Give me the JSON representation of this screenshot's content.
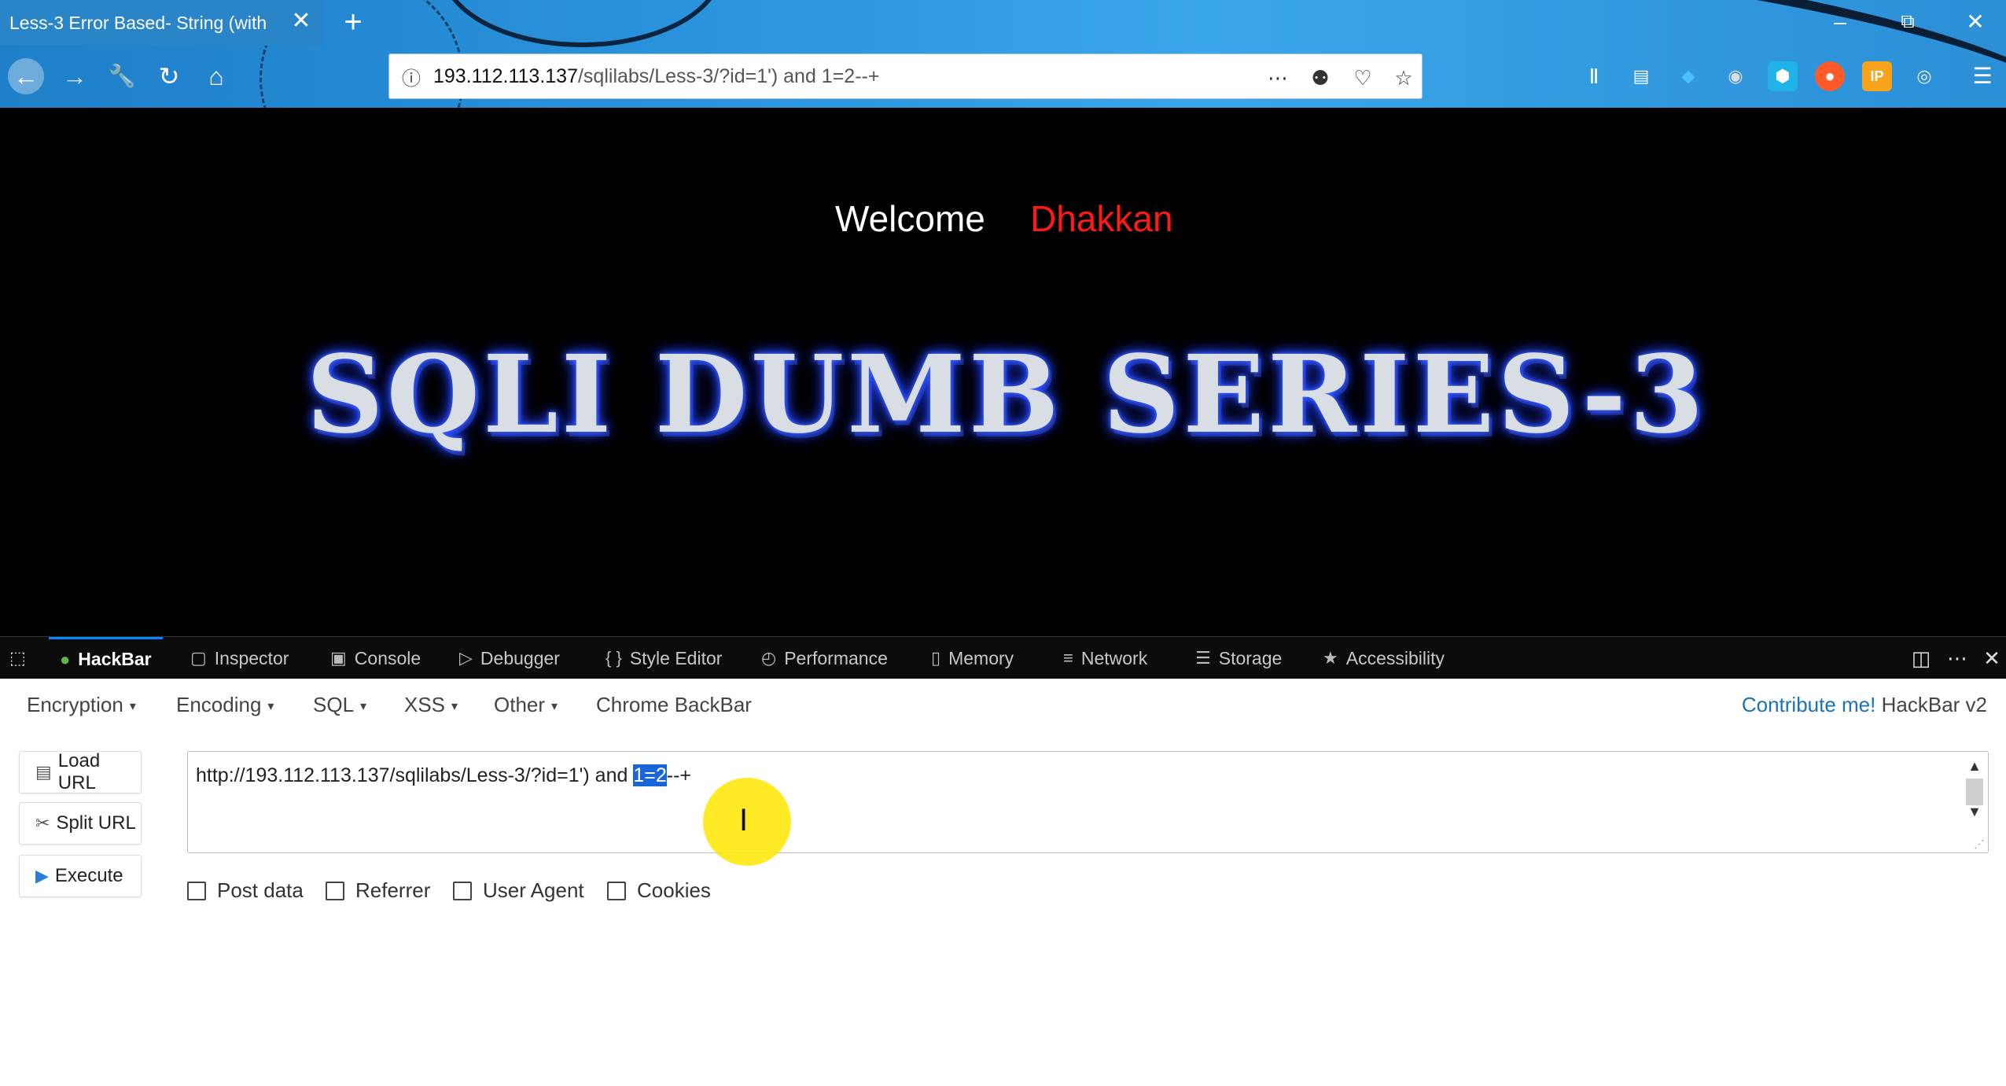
{
  "browser": {
    "tab_title": "Less-3 Error Based- String (with",
    "tab_close": "✕",
    "new_tab": "+",
    "url_host": "193.112.113.137",
    "url_rest": "/sqlilabs/Less-3/?id=1') and 1=2--+",
    "url_icons": [
      "info-icon",
      "more-icon",
      "lightbulb-icon",
      "pocket-icon",
      "star-icon"
    ],
    "toolbar_icons": [
      "library-icon",
      "reader-icon",
      "gem-icon",
      "shield-icon",
      "hexagon-icon",
      "ball-icon",
      "ip-icon",
      "globe-icon",
      "menu-icon"
    ]
  },
  "page": {
    "welcome": "Welcome",
    "user": "Dhakkan",
    "banner": "SQLI DUMB SERIES-3"
  },
  "devtools": {
    "tabs": [
      {
        "label": "HackBar",
        "icon": "hackbar-icon"
      },
      {
        "label": "Inspector",
        "icon": "inspector-icon"
      },
      {
        "label": "Console",
        "icon": "console-icon"
      },
      {
        "label": "Debugger",
        "icon": "debugger-icon"
      },
      {
        "label": "Style Editor",
        "icon": "braces-icon"
      },
      {
        "label": "Performance",
        "icon": "performance-icon"
      },
      {
        "label": "Memory",
        "icon": "memory-icon"
      },
      {
        "label": "Network",
        "icon": "network-icon"
      },
      {
        "label": "Storage",
        "icon": "storage-icon"
      },
      {
        "label": "Accessibility",
        "icon": "accessibility-icon"
      }
    ]
  },
  "hackbar": {
    "menu": [
      "Encryption",
      "Encoding",
      "SQL",
      "XSS",
      "Other",
      "Chrome BackBar"
    ],
    "contribute_link": "Contribute me!",
    "version": "HackBar v2",
    "buttons": {
      "load": "Load URL",
      "split": "Split URL",
      "execute": "Execute"
    },
    "url_before": "http://193.112.113.137/sqlilabs/Less-3/?id=1') and ",
    "url_selected": "1=2",
    "url_after": "--+",
    "options": [
      "Post data",
      "Referrer",
      "User Agent",
      "Cookies"
    ]
  },
  "colors": {
    "user": "#ff1a1a",
    "selection": "#1a66d9",
    "link": "#1a73b8",
    "cursor_highlight": "#ffe600"
  }
}
